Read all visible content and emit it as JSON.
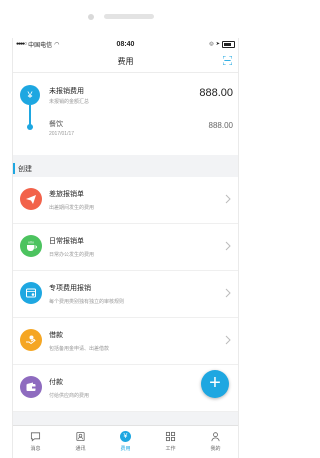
{
  "statusbar": {
    "carrier": "中国电信",
    "time": "08:40"
  },
  "navbar": {
    "title": "费用"
  },
  "summary": {
    "title": "未报销费用",
    "subtitle": "未报销的金额汇总",
    "amount": "888.00",
    "item": {
      "title": "餐饮",
      "date": "2017/01/17",
      "amount": "888.00"
    }
  },
  "section": {
    "label": "创建"
  },
  "cards": [
    {
      "name": "差旅报销单",
      "desc": "出差期间发生的费用",
      "color": "#f2624a",
      "icon": "plane-icon"
    },
    {
      "name": "日常报销单",
      "desc": "日常办公发生的费用",
      "color": "#4cc35f",
      "icon": "coffee-icon"
    },
    {
      "name": "专项费用报销",
      "desc": "每个费用类别独有独立的审核规则",
      "color": "#1ea7e1",
      "icon": "special-expense-icon"
    },
    {
      "name": "借款",
      "desc": "包括备用金申请、出差借款",
      "color": "#f5a623",
      "icon": "loan-icon"
    },
    {
      "name": "付款",
      "desc": "付给供应商的费用",
      "color": "#8e6bbf",
      "icon": "wallet-icon"
    }
  ],
  "tabs": [
    {
      "label": "消息",
      "icon": "message-icon"
    },
    {
      "label": "通讯",
      "icon": "contacts-icon"
    },
    {
      "label": "费用",
      "icon": "yen-icon",
      "active": true
    },
    {
      "label": "工作",
      "icon": "grid-icon"
    },
    {
      "label": "我的",
      "icon": "profile-icon"
    }
  ],
  "fab": {
    "label": "+"
  }
}
